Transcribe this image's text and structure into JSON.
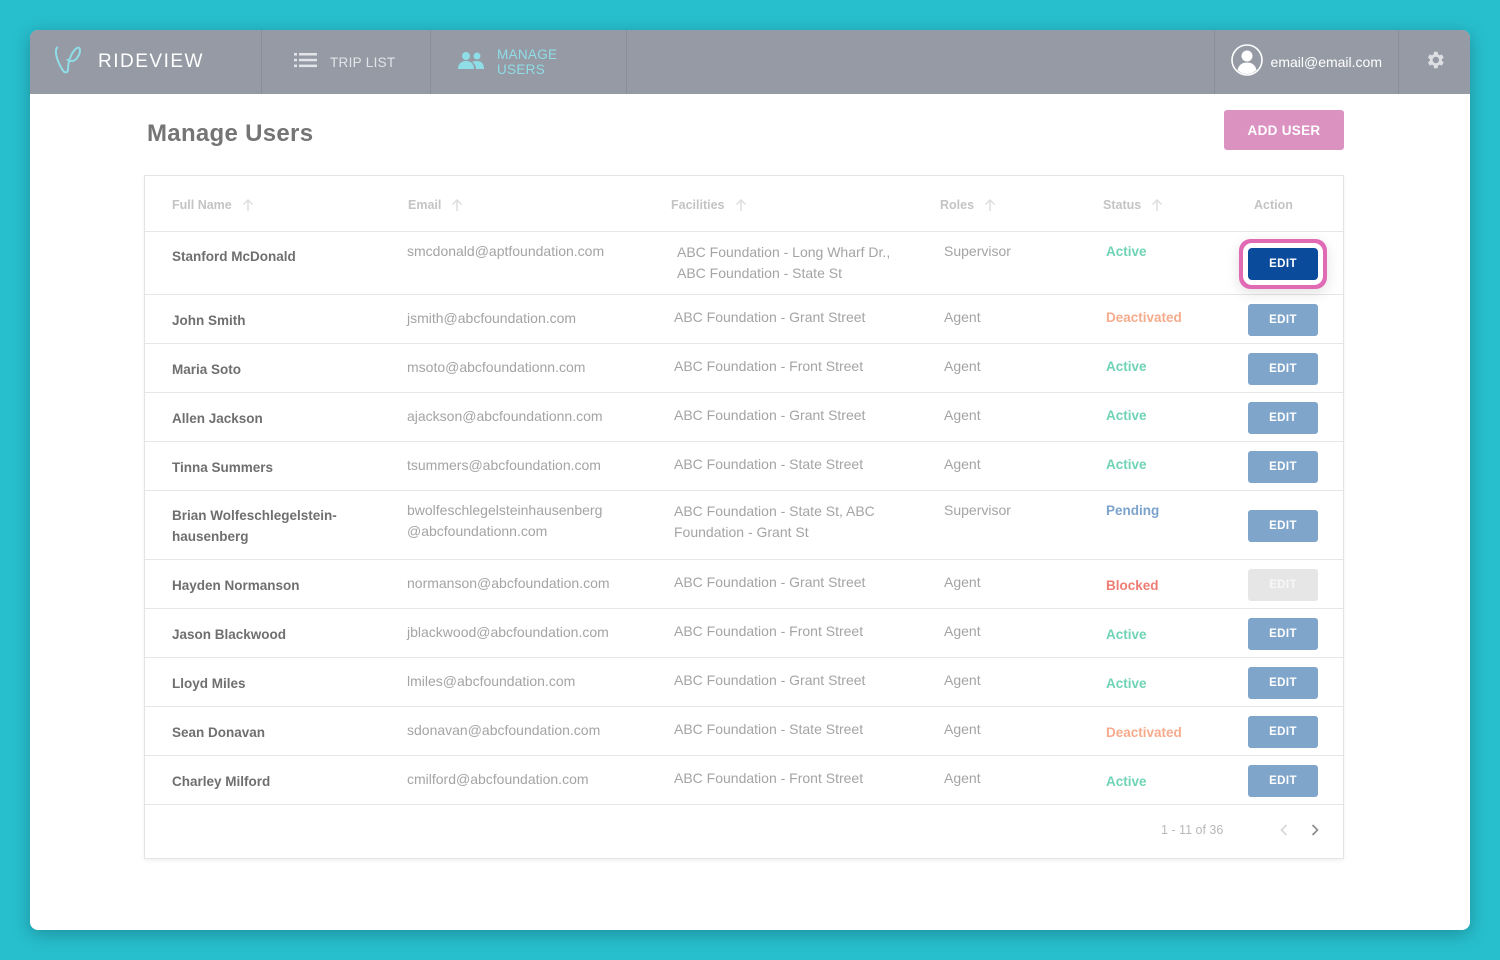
{
  "app": {
    "brand": "RIDEVIEW",
    "accent": "#8fdde7",
    "nav": [
      {
        "label": "TRIP LIST",
        "icon": "list-icon",
        "active": false
      },
      {
        "label": "MANAGE USERS",
        "icon": "users-icon",
        "active": true
      }
    ],
    "user_email": "email@email.com"
  },
  "page": {
    "title": "Manage Users",
    "add_user_label": "ADD USER"
  },
  "table": {
    "columns": [
      {
        "label": "Full Name",
        "sortable": true
      },
      {
        "label": "Email",
        "sortable": true
      },
      {
        "label": "Facilities",
        "sortable": true
      },
      {
        "label": "Roles",
        "sortable": true
      },
      {
        "label": "Status",
        "sortable": true
      },
      {
        "label": "Action",
        "sortable": false
      }
    ],
    "status_colors": {
      "Active": "#6fd3b6",
      "Deactivated": "#f6ab8c",
      "Pending": "#7ba3cc",
      "Blocked": "#ef7d75"
    },
    "rows": [
      {
        "name": "Stanford McDonald",
        "email": "smcdonald@aptfoundation.com",
        "facilities": "ABC Foundation - Long Wharf Dr., ABC Foundation - State St",
        "role": "Supervisor",
        "status": "Active",
        "action": "EDIT",
        "action_state": "focused"
      },
      {
        "name": "John Smith",
        "email": "jsmith@abcfoundation.com",
        "facilities": "ABC Foundation - Grant Street",
        "role": "Agent",
        "status": "Deactivated",
        "action": "EDIT",
        "action_state": "normal"
      },
      {
        "name": "Maria Soto",
        "email": "msoto@abcfoundationn.com",
        "facilities": "ABC Foundation - Front Street",
        "role": "Agent",
        "status": "Active",
        "action": "EDIT",
        "action_state": "normal"
      },
      {
        "name": "Allen Jackson",
        "email": "ajackson@abcfoundationn.com",
        "facilities": "ABC Foundation - Grant Street",
        "role": "Agent",
        "status": "Active",
        "action": "EDIT",
        "action_state": "normal"
      },
      {
        "name": "Tinna Summers",
        "email": "tsummers@abcfoundation.com",
        "facilities": "ABC Foundation - State Street",
        "role": "Agent",
        "status": "Active",
        "action": "EDIT",
        "action_state": "normal"
      },
      {
        "name": "Brian Wolfeschlegelstein-hausenberg",
        "email": "bwolfeschlegelsteinhausenberg @abcfoundationn.com",
        "facilities": "ABC Foundation - State St, ABC Foundation - Grant St",
        "role": "Supervisor",
        "status": "Pending",
        "action": "EDIT",
        "action_state": "normal"
      },
      {
        "name": "Hayden Normanson",
        "email": "normanson@abcfoundation.com",
        "facilities": "ABC Foundation - Grant Street",
        "role": "Agent",
        "status": "Blocked",
        "action": "EDIT",
        "action_state": "disabled"
      },
      {
        "name": "Jason Blackwood",
        "email": "jblackwood@abcfoundation.com",
        "facilities": "ABC Foundation - Front Street",
        "role": "Agent",
        "status": "Active",
        "action": "EDIT",
        "action_state": "normal"
      },
      {
        "name": "Lloyd Miles",
        "email": "lmiles@abcfoundation.com",
        "facilities": "ABC Foundation - Grant Street",
        "role": "Agent",
        "status": "Active",
        "action": "EDIT",
        "action_state": "normal"
      },
      {
        "name": "Sean Donavan",
        "email": "sdonavan@abcfoundation.com",
        "facilities": "ABC Foundation - State Street",
        "role": "Agent",
        "status": "Deactivated",
        "action": "EDIT",
        "action_state": "normal"
      },
      {
        "name": "Charley Milford",
        "email": "cmilford@abcfoundation.com",
        "facilities": "ABC Foundation - Front Street",
        "role": "Agent",
        "status": "Active",
        "action": "EDIT",
        "action_state": "normal"
      }
    ]
  },
  "pagination": {
    "range_text": "1 - 11 of 36"
  }
}
